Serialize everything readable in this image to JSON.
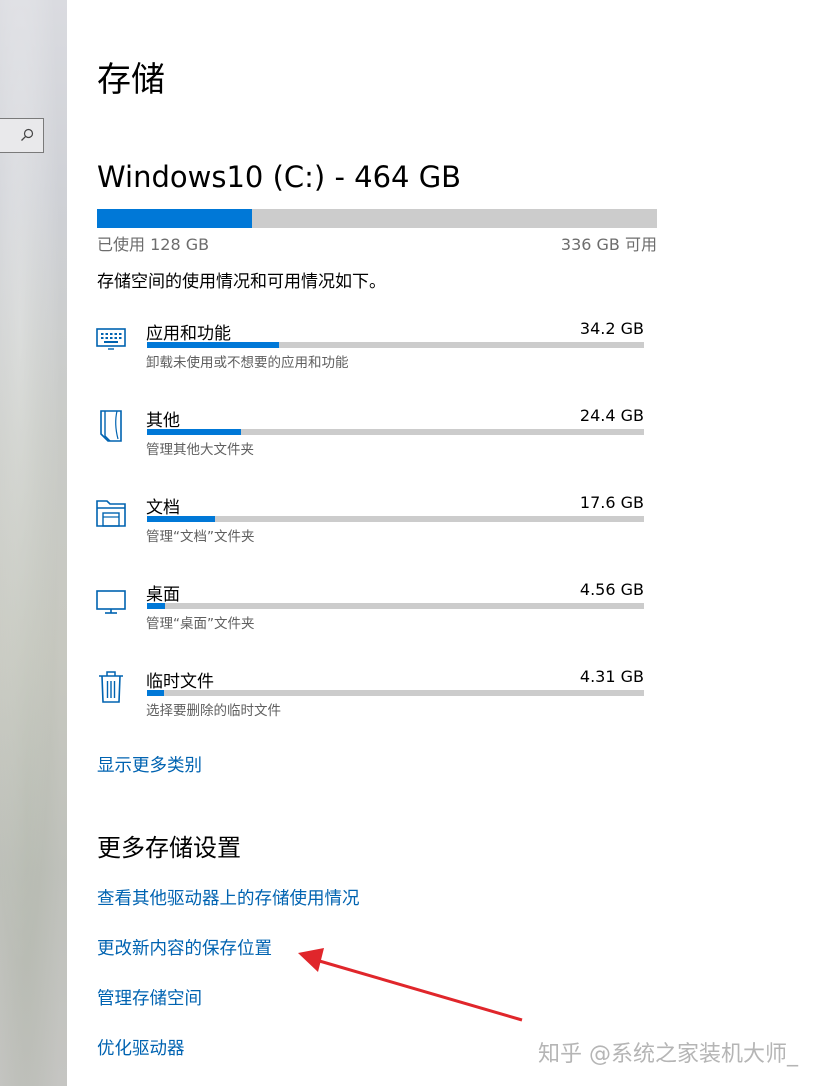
{
  "page_title": "存储",
  "drive": {
    "title": "Windows10 (C:) - 464 GB",
    "used_label": "已使用 128 GB",
    "free_label": "336 GB 可用",
    "used_fraction": 0.276
  },
  "description": "存储空间的使用情况和可用情况如下。",
  "categories": [
    {
      "name": "应用和功能",
      "size": "34.2 GB",
      "sub": "卸载未使用或不想要的应用和功能",
      "icon": "keyboard-icon",
      "fraction": 0.266
    },
    {
      "name": "其他",
      "size": "24.4 GB",
      "sub": "管理其他大文件夹",
      "icon": "document-icon",
      "fraction": 0.19
    },
    {
      "name": "文档",
      "size": "17.6 GB",
      "sub": "管理“文档”文件夹",
      "icon": "folder-icon",
      "fraction": 0.137
    },
    {
      "name": "桌面",
      "size": "4.56 GB",
      "sub": "管理“桌面”文件夹",
      "icon": "monitor-icon",
      "fraction": 0.036
    },
    {
      "name": "临时文件",
      "size": "4.31 GB",
      "sub": "选择要删除的临时文件",
      "icon": "trash-icon",
      "fraction": 0.034
    }
  ],
  "show_more": "显示更多类别",
  "more_settings": {
    "title": "更多存储设置",
    "links": [
      "查看其他驱动器上的存储使用情况",
      "更改新内容的保存位置",
      "管理存储空间",
      "优化驱动器"
    ]
  },
  "watermark": "知乎 @系统之家装机大师_",
  "colors": {
    "accent": "#0078d7",
    "link": "#0063b1",
    "annotation_arrow": "#e0262b"
  }
}
